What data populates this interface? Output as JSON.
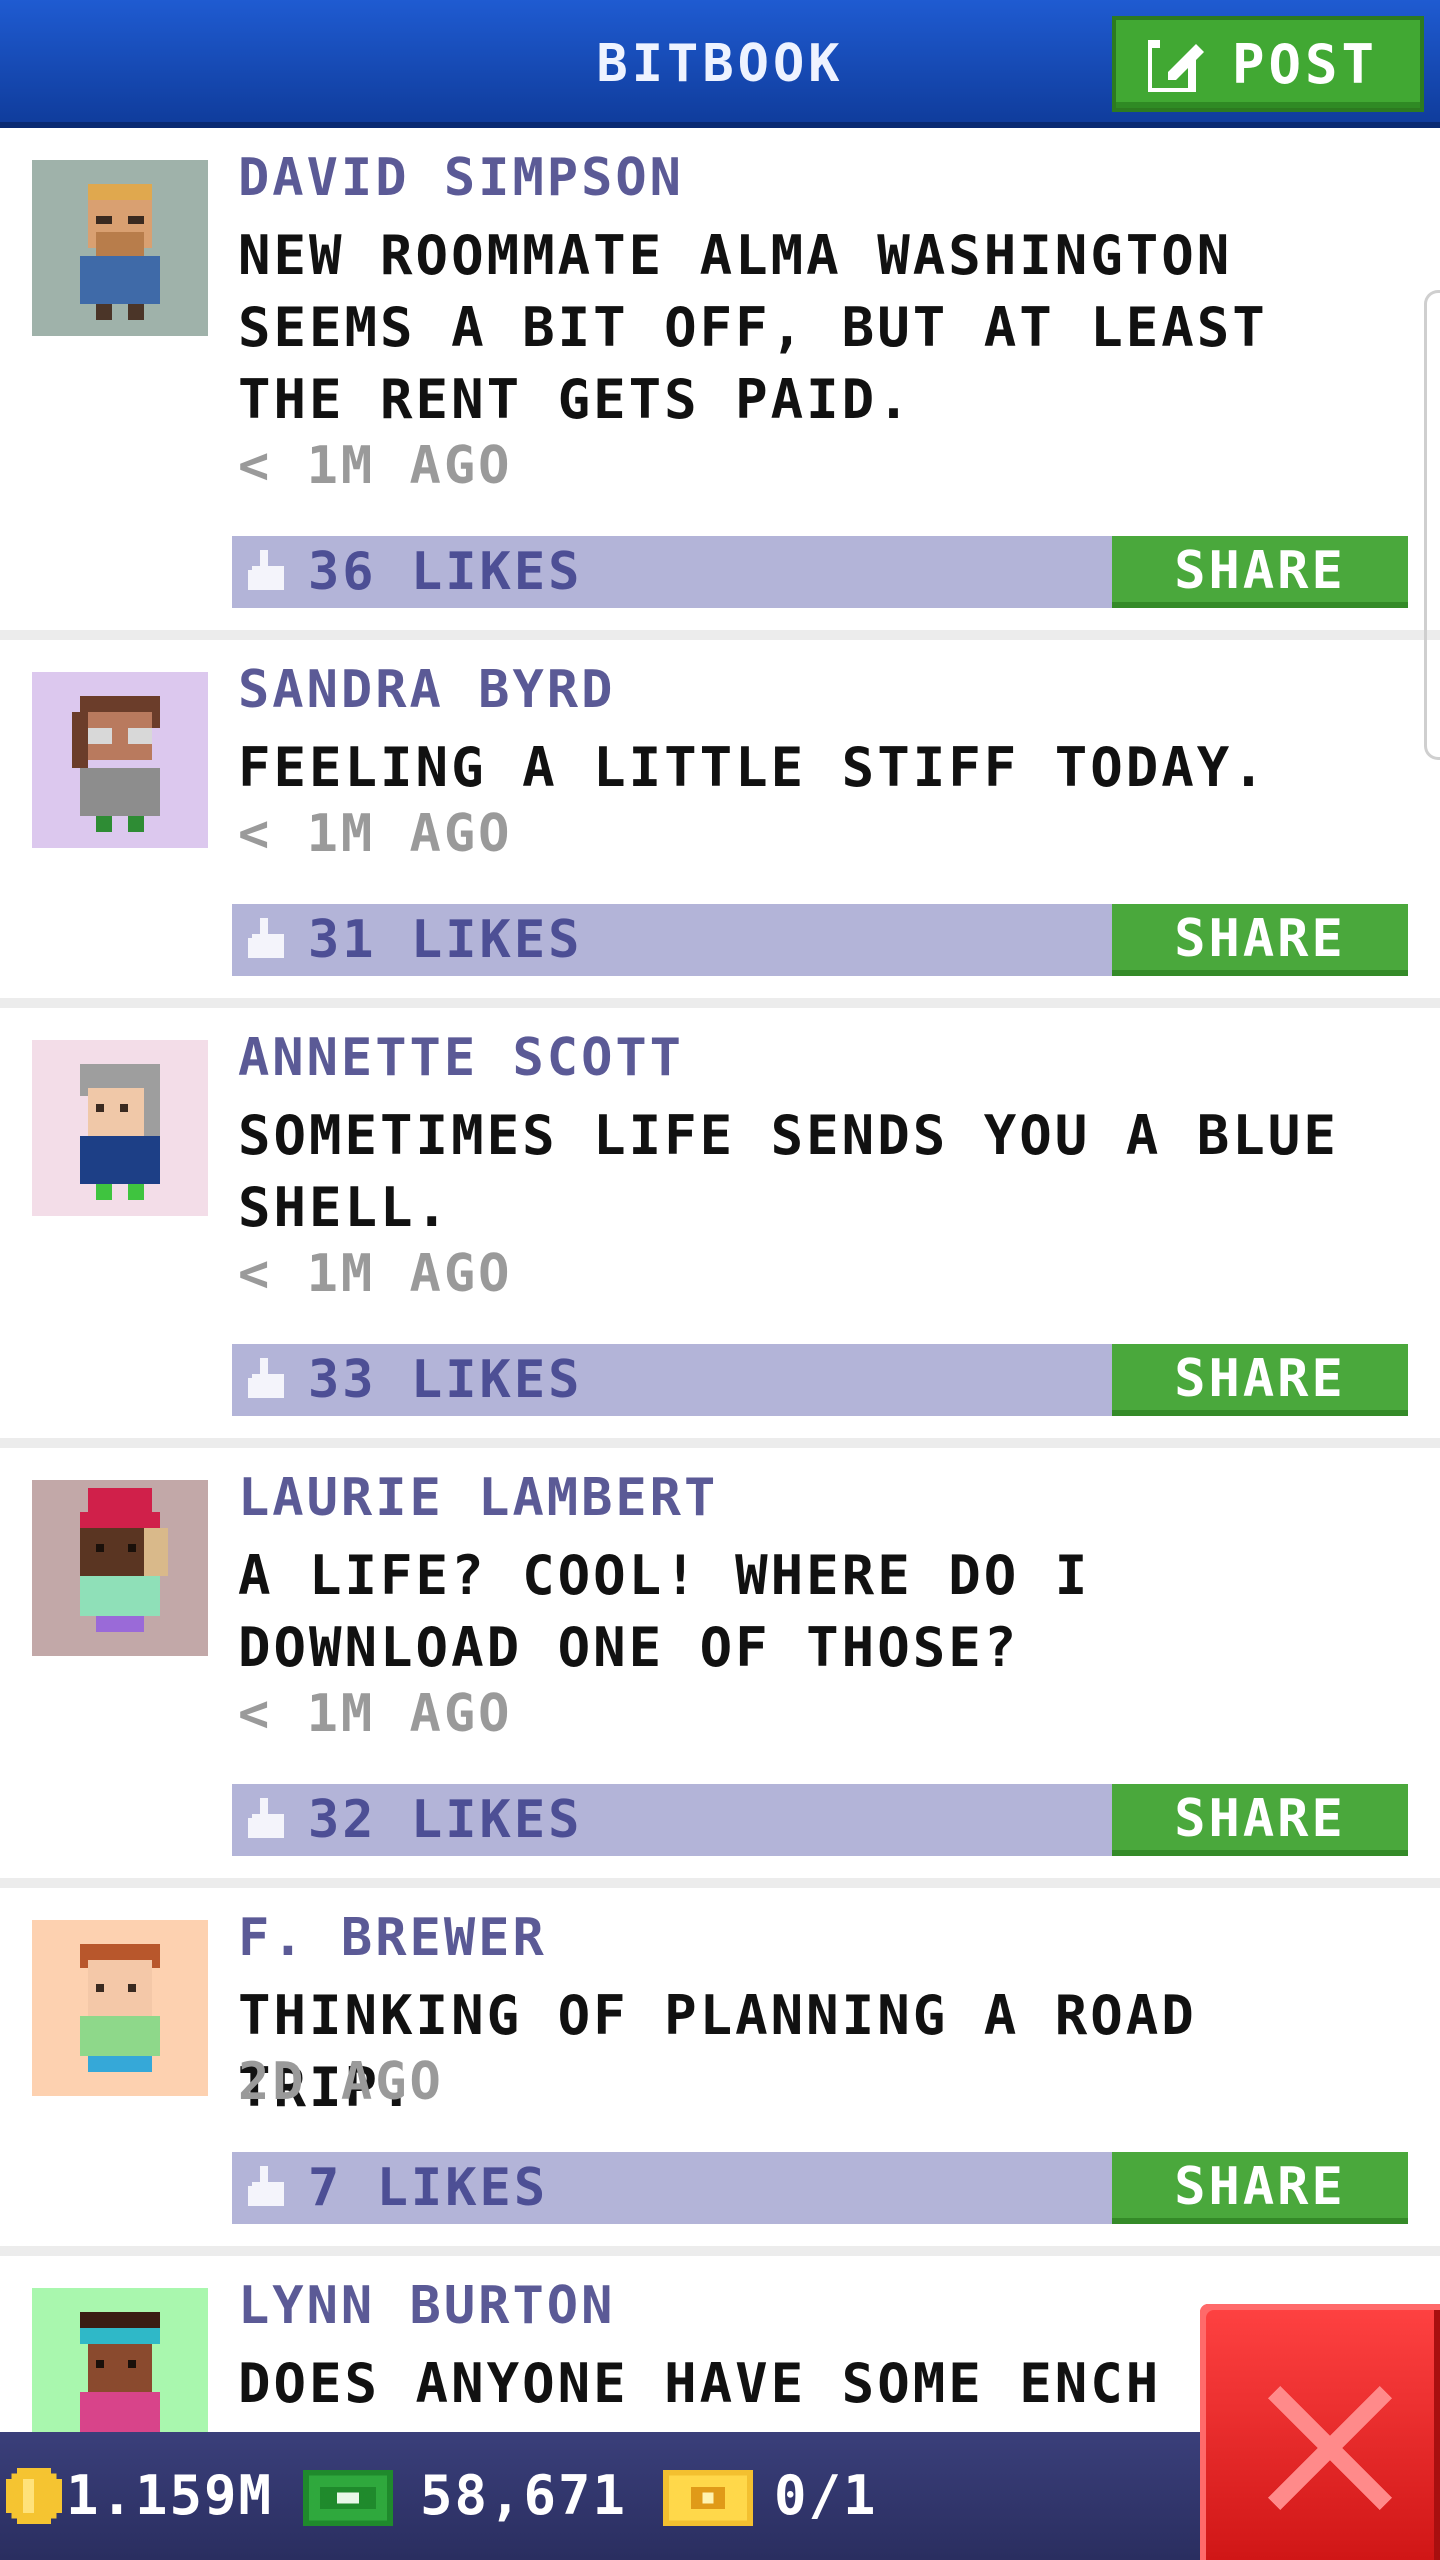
{
  "header": {
    "title": "BITBOOK",
    "post_label": "POST"
  },
  "posts": [
    {
      "author": "DAVID SIMPSON",
      "text": "NEW ROOMMATE ALMA WASHINGTON SEEMS A BIT OFF, BUT AT LEAST THE RENT GETS PAID.",
      "time": "< 1M AGO",
      "likes": "36 LIKES",
      "share": "SHARE",
      "avatar_bg": "#9fb2aa"
    },
    {
      "author": "SANDRA BYRD",
      "text": "FEELING A LITTLE STIFF TODAY.",
      "time": "< 1M AGO",
      "likes": "31 LIKES",
      "share": "SHARE",
      "avatar_bg": "#dcc8ee"
    },
    {
      "author": "ANNETTE SCOTT",
      "text": "SOMETIMES LIFE SENDS YOU A BLUE SHELL.",
      "time": "< 1M AGO",
      "likes": "33 LIKES",
      "share": "SHARE",
      "avatar_bg": "#f3dde8"
    },
    {
      "author": "LAURIE LAMBERT",
      "text": "A LIFE? COOL! WHERE DO I DOWNLOAD ONE OF THOSE?",
      "time": "< 1M AGO",
      "likes": "32 LIKES",
      "share": "SHARE",
      "avatar_bg": "#c2a8a8"
    },
    {
      "author": "F. BREWER",
      "text": "THINKING OF PLANNING A ROAD TRIP.",
      "time": "2D AGO",
      "likes": "7 LIKES",
      "share": "SHARE",
      "avatar_bg": "#fdd1b0"
    },
    {
      "author": "LYNN BURTON",
      "text": "DOES ANYONE HAVE SOME ENCH",
      "time": "",
      "likes": "",
      "share": "",
      "avatar_bg": "#a9f7ae"
    }
  ],
  "status": {
    "coins": "1.159M",
    "cash": "58,671",
    "tickets": "0/1"
  },
  "colors": {
    "accent_blue": "#1f5bd1",
    "share_green": "#4aa83c",
    "likebar": "#b3b4d8",
    "close_red": "#e42222"
  },
  "icons": {
    "post": "edit-icon",
    "like": "thumbs-up-icon",
    "coins": "coin-icon",
    "cash": "cash-icon",
    "tickets": "ticket-icon",
    "close": "close-icon"
  }
}
